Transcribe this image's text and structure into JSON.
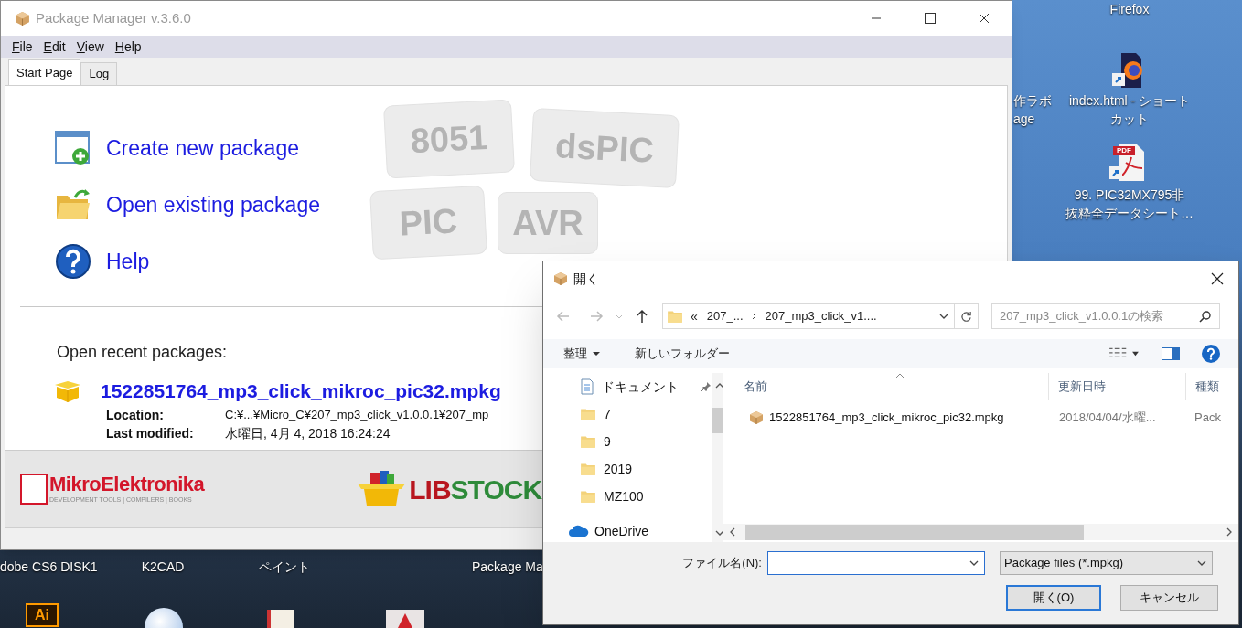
{
  "desktop_icons": [
    {
      "kind": "none",
      "label": [
        "Firefox"
      ]
    },
    {
      "kind": "firefox_shortcut",
      "label": [
        "index.html - ショート",
        "カット"
      ]
    },
    {
      "kind": "pdf_shortcut",
      "badge": "PDF",
      "label": [
        "99. PIC32MX795非",
        "抜粋全データシート…"
      ]
    },
    {
      "kind": "none",
      "label": [
        "作ラボ",
        "age"
      ]
    },
    {
      "kind": "none",
      "label": [
        "dobe CS6 DISK1"
      ]
    },
    {
      "kind": "none",
      "label": [
        "K2CAD"
      ]
    },
    {
      "kind": "none",
      "label": [
        "ペイント"
      ]
    },
    {
      "kind": "none",
      "label": [
        "Package Ma"
      ]
    },
    {
      "kind": "illustrator",
      "badge": "Ai"
    },
    {
      "kind": "globe"
    },
    {
      "kind": "document"
    },
    {
      "kind": "acrobat"
    }
  ],
  "package_manager": {
    "title": "Package Manager v.3.6.0",
    "menu": [
      {
        "mnemonic": "F",
        "rest": "ile"
      },
      {
        "mnemonic": "E",
        "rest": "dit"
      },
      {
        "mnemonic": "V",
        "rest": "iew"
      },
      {
        "mnemonic": "H",
        "rest": "elp"
      }
    ],
    "tabs": [
      {
        "label": "Start Page",
        "selected": true
      },
      {
        "label": "Log",
        "selected": false
      }
    ],
    "background_chips": [
      "8051",
      "dsPIC",
      "PIC",
      "AVR"
    ],
    "actions": [
      {
        "kind": "create",
        "label": "Create new package"
      },
      {
        "kind": "open",
        "label": "Open existing package"
      },
      {
        "kind": "help",
        "label": "Help"
      }
    ],
    "recent": {
      "heading": "Open recent packages:",
      "items": [
        {
          "name": "1522851764_mp3_click_mikroc_pic32.mpkg",
          "location_label": "Location:",
          "location": "C:¥...¥Micro_C¥207_mp3_click_v1.0.0.1¥207_mp",
          "modified_label": "Last modified:",
          "modified": "水曜日, 4月 4, 2018 16:24:24"
        }
      ]
    },
    "banner": {
      "left_logo": {
        "name": "MikroElektronika",
        "tagline": "DEVELOPMENT TOOLS | COMPILERS | BOOKS"
      },
      "right_logo": {
        "part1": "LIB",
        "part2": "STOCK"
      }
    }
  },
  "open_dialog": {
    "title": "開く",
    "breadcrumb_prefix": "«",
    "breadcrumb": [
      "207_...",
      "207_mp3_click_v1...."
    ],
    "search_placeholder": "207_mp3_click_v1.0.0.1の検索",
    "toolbar": [
      {
        "label": "整理",
        "dropdown": true
      },
      {
        "label": "新しいフォルダー",
        "dropdown": false
      }
    ],
    "nav": [
      {
        "kind": "documents",
        "label": "ドキュメント",
        "pinned": true
      },
      {
        "kind": "folder",
        "label": "7",
        "pinned": false
      },
      {
        "kind": "folder",
        "label": "9",
        "pinned": false
      },
      {
        "kind": "folder",
        "label": "2019",
        "pinned": false
      },
      {
        "kind": "folder",
        "label": "MZ100",
        "pinned": false
      },
      {
        "kind": "onedrive",
        "label": "OneDrive",
        "pinned": false
      }
    ],
    "columns": [
      "名前",
      "更新日時",
      "種類"
    ],
    "rows": [
      {
        "name": "1522851764_mp3_click_mikroc_pic32.mpkg",
        "modified": "2018/04/04/水曜...",
        "type": "Pack",
        "selected": false
      }
    ],
    "filename_label": "ファイル名(N):",
    "filter": "Package files (*.mpkg)",
    "buttons": [
      {
        "label": "開く(O)",
        "default": true
      },
      {
        "label": "キャンセル",
        "default": false
      }
    ]
  }
}
